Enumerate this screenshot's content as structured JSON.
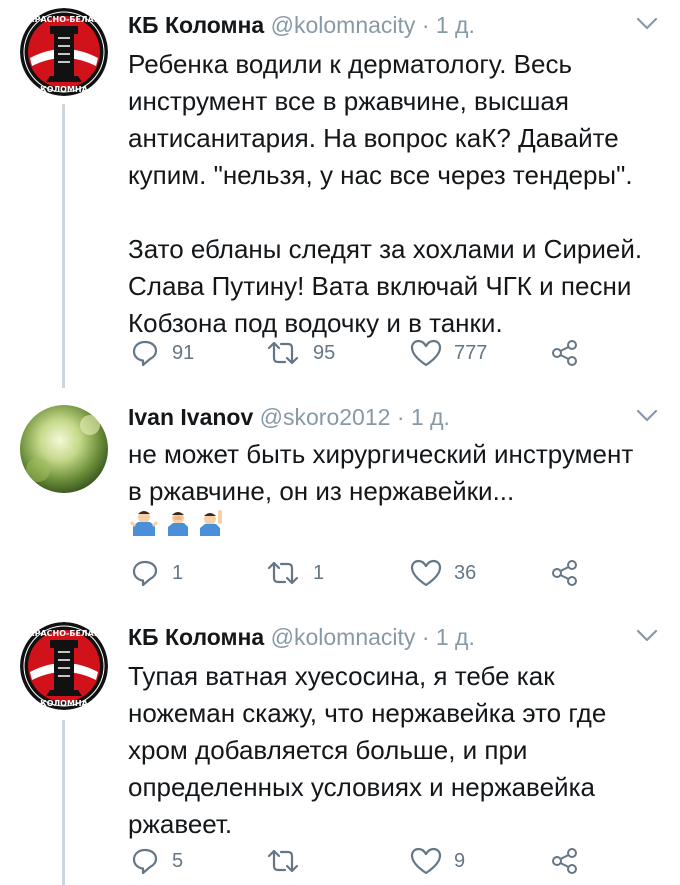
{
  "tweets": [
    {
      "name": "КБ Коломна",
      "handle": "@kolomnacity",
      "sep": "·",
      "time": "1 д.",
      "text": "Ребенка водили к дерматологу.  Весь\nинструмент все в ржавчине, высшая\nантисанитария. На вопрос каК? Давайте\nкупим. \"нельзя, у нас все через тендеры\".\n\nЗато ебланы следят за хохлами и Сирией.\nСлава Путину! Вата включай ЧГК и песни\nКобзона под водочку и в танки.",
      "replies": "91",
      "retweets": "95",
      "likes": "777",
      "avatar": "spartak-club-logo"
    },
    {
      "name": "Ivan Ivanov",
      "handle": "@skoro2012",
      "sep": "·",
      "time": "1 д.",
      "text": "не может быть хирургический инструмент\nв ржавчине, он из нержавейки...",
      "emoji": [
        "man-shrugging-emoji",
        "man-facepalming-emoji",
        "man-raising-hand-emoji"
      ],
      "replies": "1",
      "retweets": "1",
      "likes": "36",
      "avatar": "green-bokeh-photo"
    },
    {
      "name": "КБ Коломна",
      "handle": "@kolomnacity",
      "sep": "·",
      "time": "1 д.",
      "text": "Тупая ватная хуесосина, я тебе как\nножеман скажу, что нержавейка это где\nхром добавляется больше, и при\nопределенных условиях и нержавейка\nржавеет.",
      "replies": "5",
      "retweets": "",
      "likes": "9",
      "avatar": "spartak-club-logo"
    }
  ],
  "colors": {
    "text": "#14171a",
    "secondary": "#8899a6",
    "icon": "#657786",
    "thread_line": "#ccd6dd",
    "logo_red": "#d2121b"
  }
}
